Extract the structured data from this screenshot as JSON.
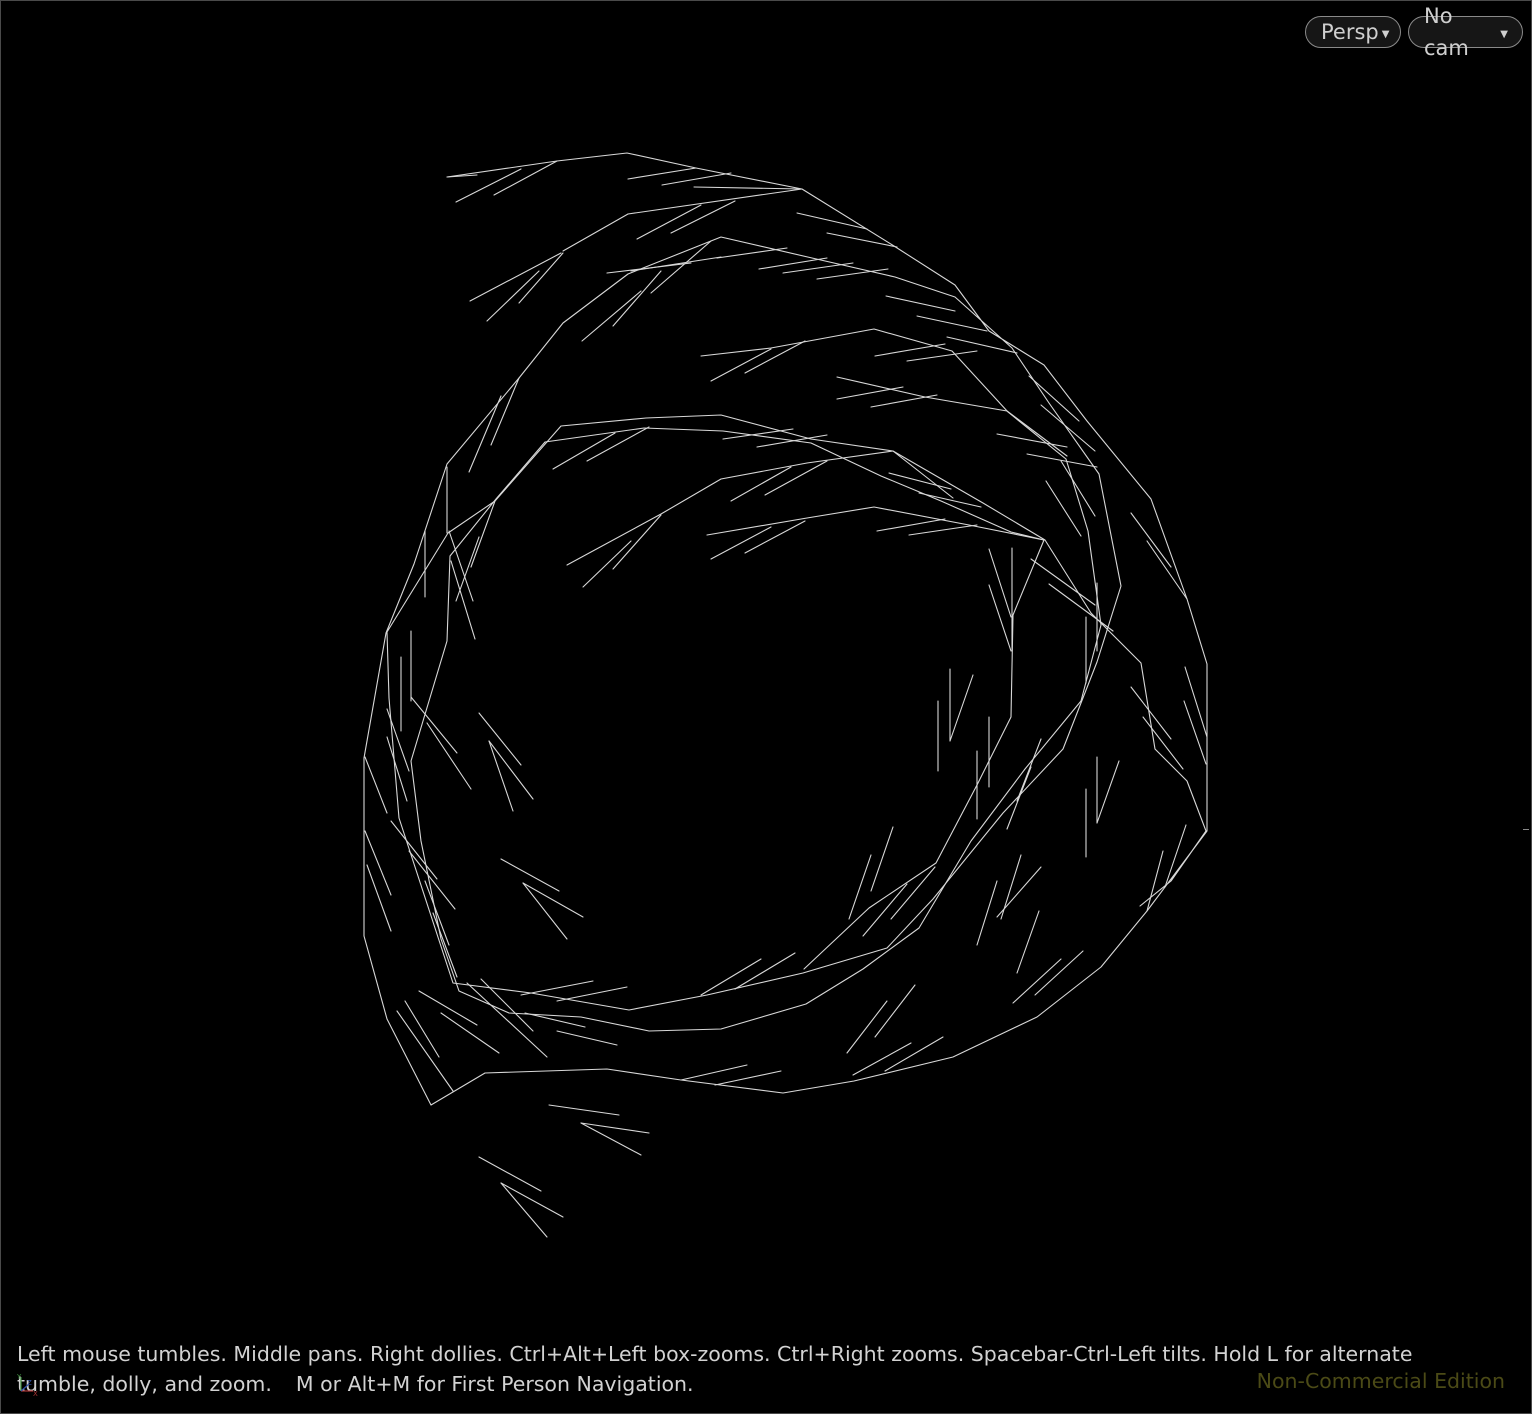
{
  "viewport": {
    "camera_mode_button": "Persp",
    "camera_select_button": "No cam",
    "dropdown_icon": "caret-down-icon",
    "help_text_1": "Left mouse tumbles. Middle pans. Right dollies. Ctrl+Alt+Left box-zooms. Ctrl+Right zooms. Spacebar-Ctrl-Left tilts. Hold L for alternate tumble, dolly, and zoom.",
    "help_text_2": "M or Alt+M for First Person Navigation.",
    "edition_label": "Non-Commercial Edition",
    "axis_labels": [
      "Y",
      "Z",
      "X"
    ],
    "colors": {
      "background": "#000000",
      "wireframe": "#d8d8d8",
      "edition": "#4b4a16"
    }
  }
}
